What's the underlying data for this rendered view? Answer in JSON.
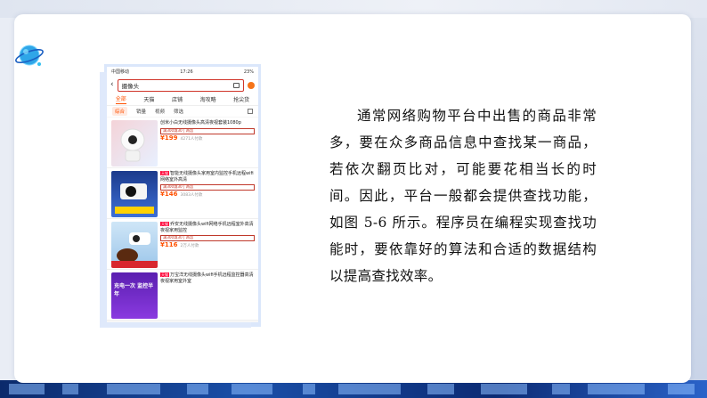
{
  "phone": {
    "status": {
      "carrier": "中国移动",
      "time": "17:26",
      "battery": "23%"
    },
    "search": {
      "query": "摄像头"
    },
    "tabs": [
      "全部",
      "天猫",
      "店铺",
      "淘攻略",
      "抢尖货"
    ],
    "filters": [
      "综合",
      "销量",
      "视频",
      "筛选"
    ],
    "items": [
      {
        "tag": "",
        "title": "创米小白无线摄像头高清夜视套装1080p",
        "promo": "满300减30 | 两店",
        "price": "¥199",
        "sold": "4271人付款",
        "shop": ""
      },
      {
        "tag": "天猫",
        "title": "智能无线摄像头家用室内监控手机远程wifi网络室外高清",
        "promo": "满300减30 | 两店",
        "price": "¥146",
        "sold": "3083人付款",
        "shop": ""
      },
      {
        "tag": "天猫",
        "title": "乔安无线摄像头wifi网络手机远程室外高清夜视家用监控",
        "promo": "满300减30 | 两店",
        "price": "¥116",
        "sold": "2万人付款",
        "shop": ""
      },
      {
        "tag": "天猫",
        "title": "万宝洋无线摄像头wifi手机远程监控器高清夜视家用室外室",
        "promo": "",
        "price": "",
        "sold": "",
        "shop": ""
      }
    ],
    "thumb_banners": [
      "",
      "",
      "",
      "充电一次 监控半年"
    ]
  },
  "paragraph": "通常网络购物平台中出售的商品非常多，要在众多商品信息中查找某一商品，若依次翻页比对，可能要花相当长的时间。因此，平台一般都会提供查找功能，如图 5-6 所示。程序员在编程实现查找功能时，要依靠好的算法和合适的数据结构以提高查找效率。",
  "colors": {
    "accent": "#ff5000",
    "tmall_red": "#ff0036",
    "frame_blue": "#1a4fa8"
  }
}
